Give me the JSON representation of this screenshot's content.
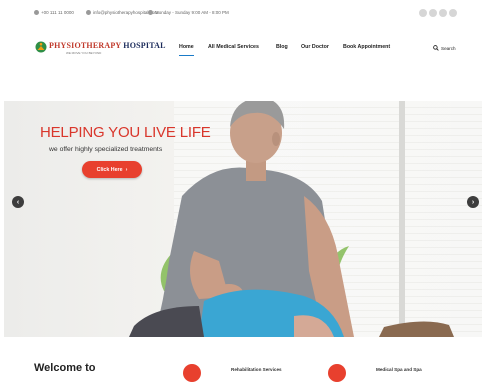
{
  "topbar": {
    "phone": "+00 111 11 0000",
    "email": "info@physiotherapyhospital.com",
    "hours": "Monday - Sunday 9:00 AM - 8:00 PM",
    "social_icons": [
      "facebook-icon",
      "twitter-icon",
      "instagram-icon",
      "youtube-icon"
    ]
  },
  "logo": {
    "word1": "PHYSIOTHERAPY",
    "word2": "HOSPITAL",
    "tagline": "WE MOVE YOU BEYOND"
  },
  "nav": {
    "items": [
      "Home",
      "All Medical Services",
      "Blog",
      "Our Doctor",
      "Book Appointment"
    ],
    "active": "Home",
    "search_label": "Search"
  },
  "hero": {
    "title": "HELPING YOU LIVE LIFE",
    "subtitle": "we offer highly specialized treatments",
    "button_label": "Click Here",
    "button_arrow": "›",
    "prev_arrow": "‹",
    "next_arrow": "›"
  },
  "below": {
    "welcome": "Welcome to",
    "features": [
      "Rehabilitation Services",
      "Medical Spa and Spa"
    ]
  },
  "colors": {
    "accent": "#e8402e",
    "brand_red": "#c0392b",
    "brand_navy": "#1a2a5a",
    "nav_active": "#1a7bc8"
  }
}
